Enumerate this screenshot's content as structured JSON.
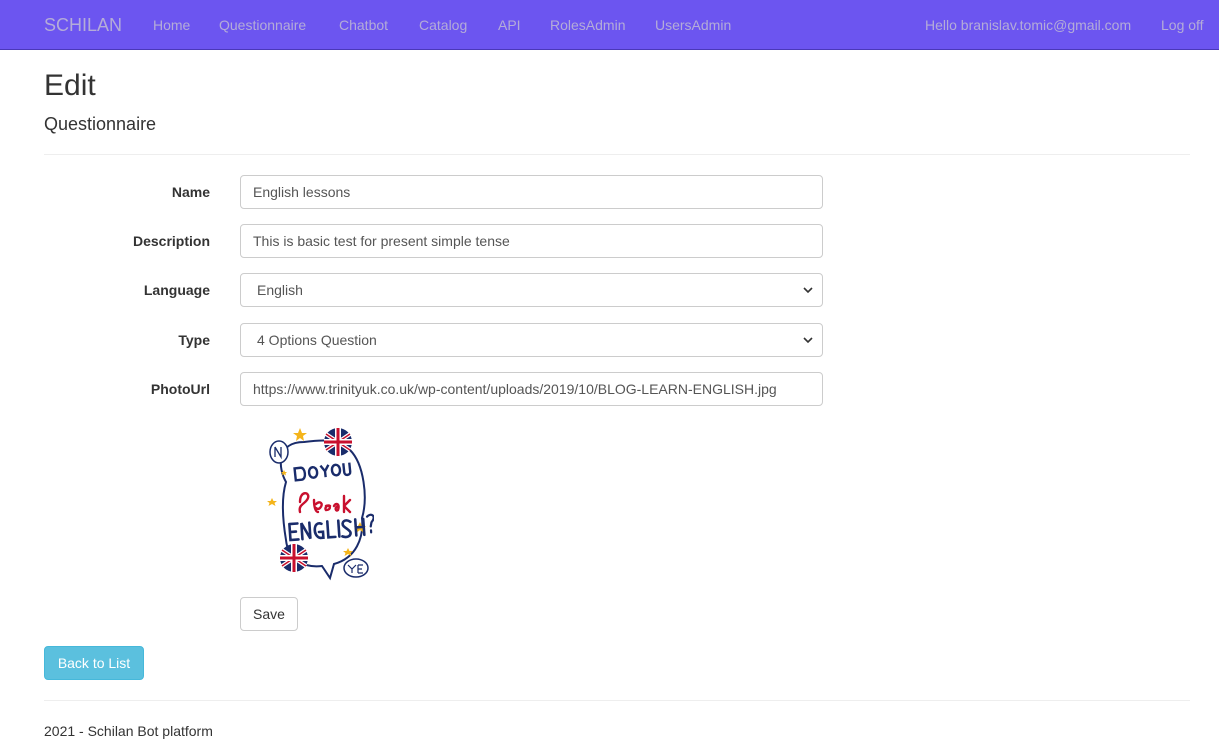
{
  "nav": {
    "brand": "SCHILAN",
    "links": [
      "Home",
      "Questionnaire",
      "Chatbot",
      "Catalog",
      "API",
      "RolesAdmin",
      "UsersAdmin"
    ],
    "greeting": "Hello branislav.tomic@gmail.com",
    "logoff": "Log off"
  },
  "page": {
    "title": "Edit",
    "subtitle": "Questionnaire"
  },
  "form": {
    "name": {
      "label": "Name",
      "value": "English lessons"
    },
    "description": {
      "label": "Description",
      "value": "This is basic test for present simple tense"
    },
    "language": {
      "label": "Language",
      "selected": "English"
    },
    "type": {
      "label": "Type",
      "selected": "4 Options Question"
    },
    "photo_url": {
      "label": "PhotoUrl",
      "value": "https://www.trinityuk.co.uk/wp-content/uploads/2019/10/BLOG-LEARN-ENGLISH.jpg"
    },
    "photo_text": "DO YOU Speak ENGLISH? NO! YES!",
    "save_label": "Save"
  },
  "back_label": "Back to List",
  "footer": "2021 - Schilan Bot platform",
  "colors": {
    "navbar": "#6c55f0",
    "nav_text": "#b4acd8",
    "info_button": "#5bc0de"
  }
}
